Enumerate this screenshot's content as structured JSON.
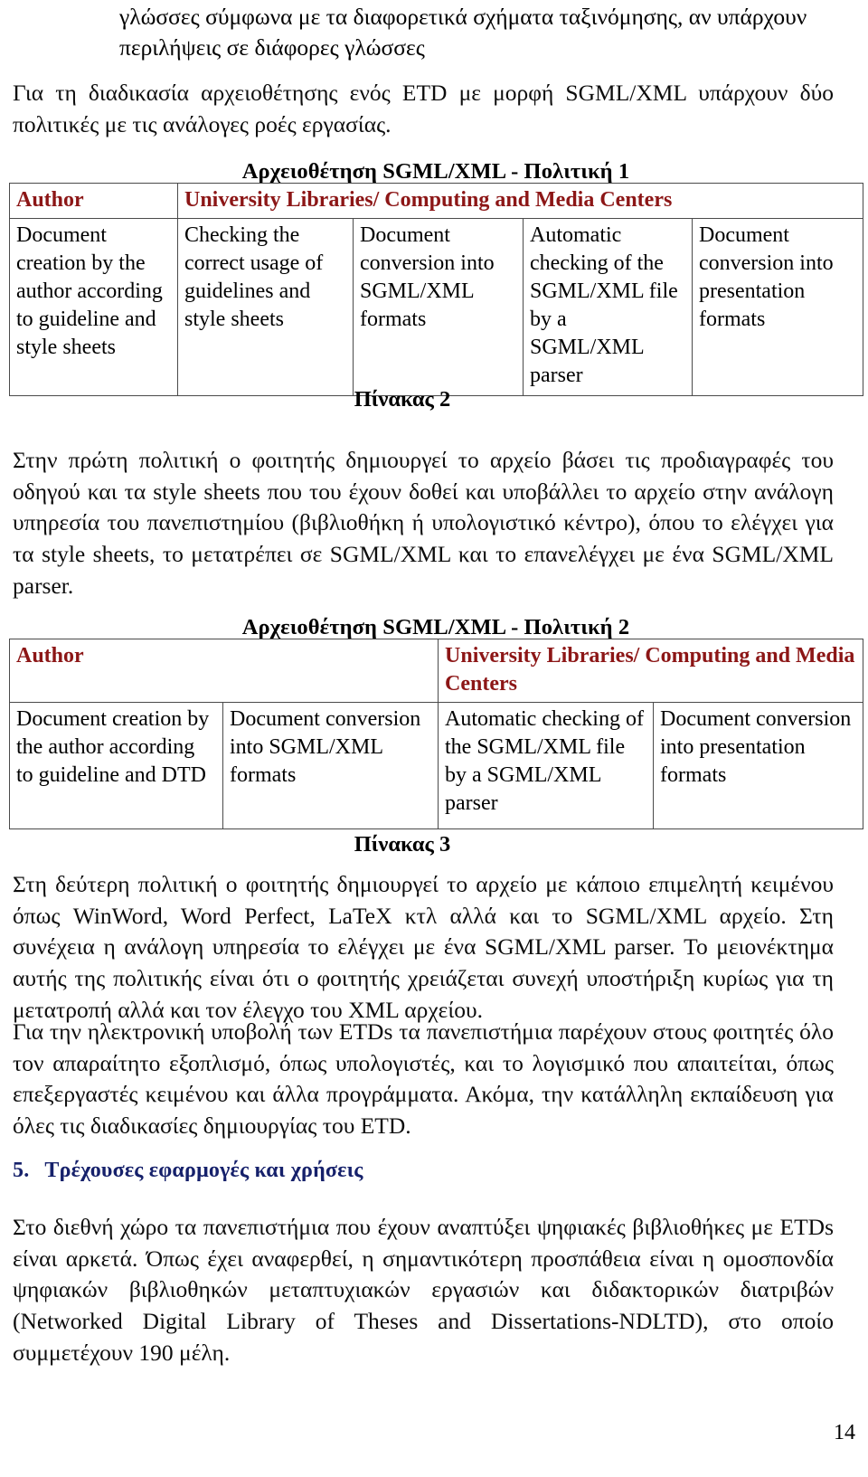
{
  "document": {
    "page_number": "14",
    "intro_lines": [
      "γλώσσες σύμφωνα με τα διαφορετικά σχήματα ταξινόμησης, αν υπάρχουν",
      "περιλήψεις σε διάφορες γλώσσες"
    ],
    "paragraph_2": "Για τη διαδικασία αρχειοθέτησης ενός ETD με μορφή SGML/XML υπάρχουν δύο πολιτικές με τις ανάλογες ροές εργασίας.",
    "paragraph_3": "Στην πρώτη πολιτική ο φοιτητής δημιουργεί το αρχείο βάσει τις προδιαγραφές του οδηγού και τα style sheets που του έχουν δοθεί και υποβάλλει το αρχείο στην ανάλογη υπηρεσία του πανεπιστημίου (βιβλιοθήκη ή υπολογιστικό κέντρο), όπου το ελέγχει για τα style sheets, το μετατρέπει σε SGML/XML και το επανελέγχει με ένα SGML/XML parser.",
    "paragraph_4": "Στη δεύτερη πολιτική ο φοιτητής  δημιουργεί το αρχείο με κάποιο επιμελητή κειμένου όπως WinWord, Word Perfect, LaTeX κτλ αλλά και το SGML/XML αρχείο. Στη συνέχεια η ανάλογη υπηρεσία το ελέγχει με ένα SGML/XML parser. Το μειονέκτημα αυτής της πολιτικής είναι ότι ο φοιτητής χρειάζεται συνεχή υποστήριξη κυρίως για τη μετατροπή αλλά και τον έλεγχο του XML αρχείου.",
    "paragraph_5": "Για την ηλεκτρονική υποβολή των ETDs τα πανεπιστήμια παρέχουν στους φοιτητές όλο τον απαραίτητο εξοπλισμό, όπως υπολογιστές, και το λογισμικό που απαιτείται, όπως επεξεργαστές κειμένου και άλλα προγράμματα. Ακόμα, την κατάλληλη εκπαίδευση για όλες τις διαδικασίες δημιουργίας του ETD.",
    "paragraph_6": "Στο διεθνή χώρο τα πανεπιστήμια που έχουν αναπτύξει ψηφιακές βιβλιοθήκες με ETDs είναι αρκετά. Όπως έχει αναφερθεί, η σημαντικότερη προσπάθεια είναι η ομοσπονδία ψηφιακών βιβλιοθηκών μεταπτυχιακών εργασιών και διδακτορικών διατριβών (Networked Digital Library of Theses and Dissertations-NDLTD), στο οποίο συμμετέχουν 190 μέλη."
  },
  "section": {
    "number": "5.",
    "title": "Τρέχουσες εφαρμογές και χρήσεις",
    "color": "#16216b"
  },
  "table1": {
    "title": "Αρχειοθέτηση SGML/XML - Πολιτική 1",
    "caption": "Πίνακας 2",
    "header_color": "#8c1616",
    "headers": [
      "Author",
      "University Libraries/ Computing and Media Centers"
    ],
    "cells": [
      "Document creation by the author according to guideline and style sheets",
      "Checking the correct usage of guidelines and style sheets",
      "Document conversion into SGML/XML formats",
      "Automatic checking of the SGML/XML file by a SGML/XML parser",
      "Document conversion into presentation formats"
    ]
  },
  "table2": {
    "title": "Αρχειοθέτηση SGML/XML - Πολιτική 2",
    "caption": "Πίνακας 3",
    "header_color": "#8c1616",
    "headers": [
      "Author",
      "University Libraries/ Computing and Media Centers"
    ],
    "cells": [
      "Document creation by the author according to guideline and DTD",
      "Document conversion into SGML/XML formats",
      "Automatic checking of the SGML/XML file by a SGML/XML parser",
      "Document conversion into presentation formats"
    ]
  }
}
